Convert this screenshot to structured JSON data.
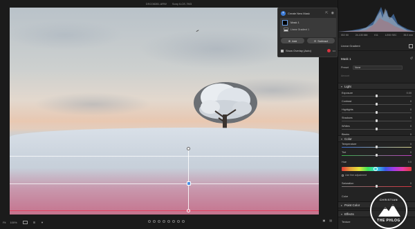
{
  "titlebar": {
    "filename": "DSC08281.ARW",
    "camera": "Sony ILCE-7M3"
  },
  "mask_panel": {
    "create_label": "Create New Mask",
    "mask_name": "Mask 1",
    "component": "Linear Gradient 1",
    "add_label": "Add",
    "subtract_label": "Subtract",
    "overlay_label": "Show Overlay (Auto)"
  },
  "histogram": {
    "iso": "ISO 50",
    "focal": "24-105 MM",
    "aperture": "f/11",
    "shutter": "1/200 SEC",
    "focal2": "35.0 mm"
  },
  "panel": {
    "tool_title": "Linear Gradient",
    "mask_title": "Mask 1",
    "preset_label": "Preset",
    "preset_value": "None",
    "amount_label": "Amount",
    "sections": {
      "light": "Light",
      "color": "Color",
      "point_color": "Point Color",
      "effects": "Effects"
    },
    "light_sliders": [
      {
        "label": "Exposure",
        "value": "0.00",
        "pos": 0.5
      },
      {
        "label": "Contrast",
        "value": "0",
        "pos": 0.5
      },
      {
        "label": "Highlights",
        "value": "0",
        "pos": 0.5
      },
      {
        "label": "Shadows",
        "value": "0",
        "pos": 0.5
      },
      {
        "label": "Whites",
        "value": "0",
        "pos": 0.5
      },
      {
        "label": "Blacks",
        "value": "0",
        "pos": 0.5
      }
    ],
    "color_sliders": [
      {
        "label": "Temperature",
        "value": "0",
        "pos": 0.5
      },
      {
        "label": "Tint",
        "value": "0",
        "pos": 0.5
      }
    ],
    "hue_label": "Hue",
    "hue_value": "0.0",
    "fine_label": "Use fine adjustment",
    "saturation_label": "Saturation",
    "saturation_value": "0",
    "color_label": "Color",
    "texture_label": "Texture"
  },
  "watermark": {
    "top": "CHRISTIAN",
    "bottom": "THE PHLOG"
  },
  "bottom": {
    "zoom1": "Fit",
    "zoom2": "100%"
  }
}
